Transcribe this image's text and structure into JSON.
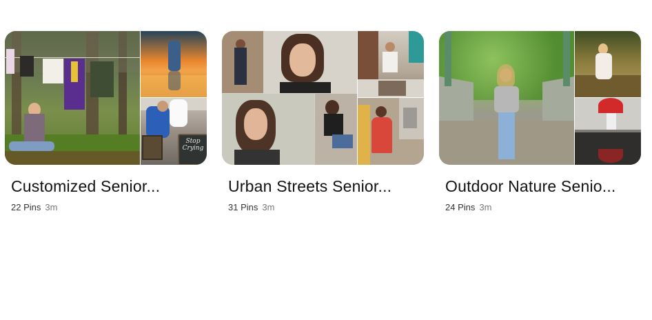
{
  "boards": [
    {
      "title": "Customized Senior...",
      "pins": "22 Pins",
      "time": "3m",
      "chalkboard_text": "Stop Crying"
    },
    {
      "title": "Urban Streets Senior...",
      "pins": "31 Pins",
      "time": "3m"
    },
    {
      "title": "Outdoor Nature Senio...",
      "pins": "24 Pins",
      "time": "3m"
    }
  ],
  "colors": {
    "title": "#111111",
    "meta": "#333333",
    "time": "#767676",
    "background": "#ffffff"
  }
}
